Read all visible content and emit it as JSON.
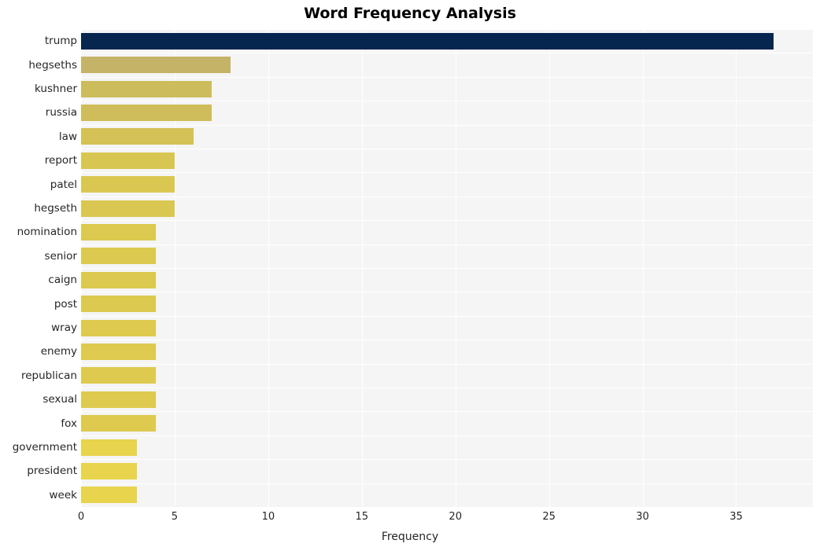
{
  "chart_data": {
    "type": "bar",
    "orientation": "horizontal",
    "title": "Word Frequency Analysis",
    "xlabel": "Frequency",
    "ylabel": "",
    "categories": [
      "trump",
      "hegseths",
      "kushner",
      "russia",
      "law",
      "report",
      "patel",
      "hegseth",
      "nomination",
      "senior",
      "caign",
      "post",
      "wray",
      "enemy",
      "republican",
      "sexual",
      "fox",
      "government",
      "president",
      "week"
    ],
    "values": [
      37,
      8,
      7,
      7,
      6,
      5,
      5,
      5,
      4,
      4,
      4,
      4,
      4,
      4,
      4,
      4,
      4,
      3,
      3,
      3
    ],
    "xlim": [
      0,
      39.1
    ],
    "xticks": [
      0,
      5,
      10,
      15,
      20,
      25,
      30,
      35
    ],
    "xticklabels": [
      "0",
      "5",
      "10",
      "15",
      "20",
      "25",
      "30",
      "35"
    ],
    "grid": true,
    "grid_color": "#ffffff",
    "legend": "none",
    "plot_background": "#f5f5f5",
    "figure_background": "#ffffff",
    "bar_colors": [
      "#06254f",
      "#c5b467",
      "#cdbc5c",
      "#cebd5a",
      "#d4c256",
      "#d8c653",
      "#d9c752",
      "#d9c752",
      "#dcc94f",
      "#dcc94f",
      "#dcc94f",
      "#dcc94f",
      "#ddca4f",
      "#ddca4f",
      "#ddca4f",
      "#ddca4f",
      "#ddca4f",
      "#e8d44d",
      "#e8d44d",
      "#e8d44d"
    ]
  }
}
